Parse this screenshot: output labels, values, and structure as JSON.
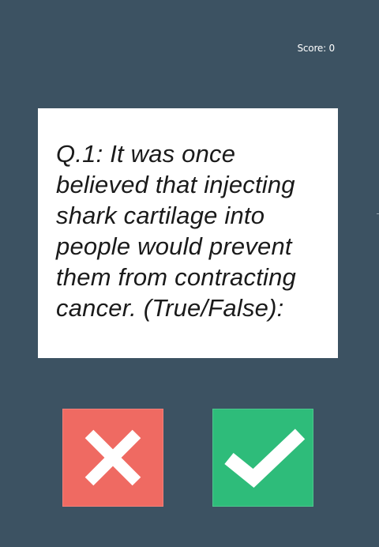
{
  "header": {
    "score_label": "Score: 0"
  },
  "question": {
    "text": "Q.1: It was once believed that injecting shark cartilage into people would prevent them from contracting cancer. (True/False):"
  },
  "answers": {
    "false_icon": "close-icon",
    "true_icon": "check-icon"
  },
  "colors": {
    "background": "#3c5262",
    "card": "#ffffff",
    "false_button": "#ef6a62",
    "true_button": "#2ebc7a",
    "icon": "#ffffff"
  }
}
